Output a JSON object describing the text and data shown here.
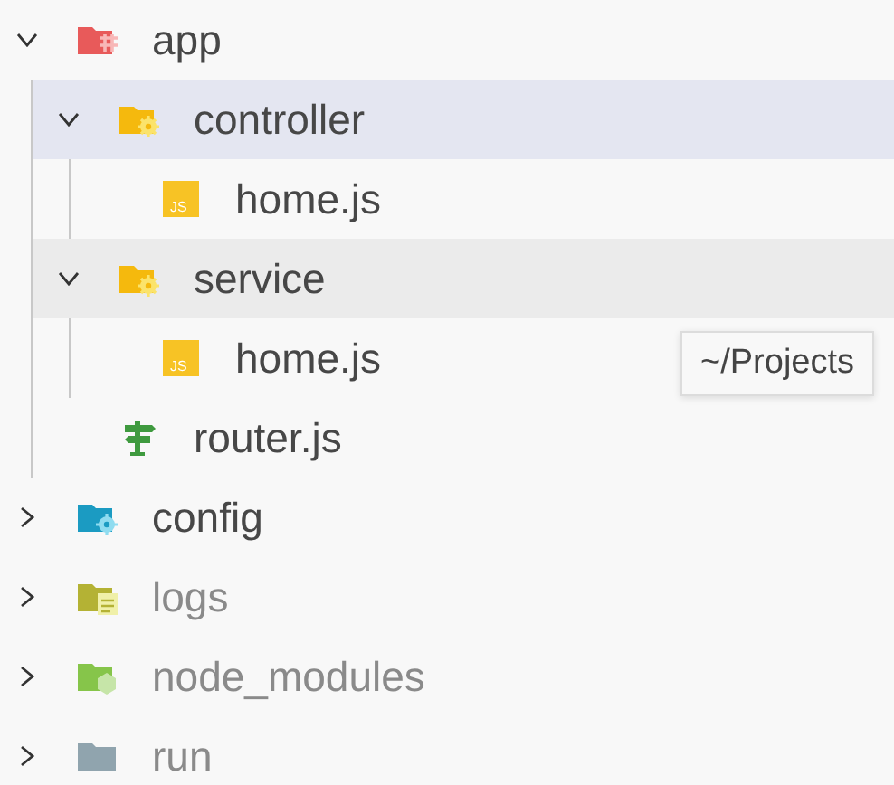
{
  "tree": [
    {
      "name": "app",
      "kind": "folder-app",
      "expanded": true,
      "selected": false,
      "hovered": false,
      "dimmed": false,
      "children": [
        {
          "name": "controller",
          "kind": "folder-gear",
          "expanded": true,
          "selected": true,
          "hovered": false,
          "dimmed": false,
          "children": [
            {
              "name": "home.js",
              "kind": "js",
              "icon_text": "JS",
              "selected": false,
              "hovered": false,
              "dimmed": false
            }
          ]
        },
        {
          "name": "service",
          "kind": "folder-gear",
          "expanded": true,
          "selected": false,
          "hovered": true,
          "dimmed": false,
          "children": [
            {
              "name": "home.js",
              "kind": "js",
              "icon_text": "JS",
              "selected": false,
              "hovered": false,
              "dimmed": false
            }
          ]
        },
        {
          "name": "router.js",
          "kind": "signpost",
          "selected": false,
          "hovered": false,
          "dimmed": false
        }
      ]
    },
    {
      "name": "config",
      "kind": "folder-config",
      "expanded": false,
      "selected": false,
      "hovered": false,
      "dimmed": false
    },
    {
      "name": "logs",
      "kind": "folder-logs",
      "expanded": false,
      "selected": false,
      "hovered": false,
      "dimmed": true
    },
    {
      "name": "node_modules",
      "kind": "folder-node",
      "expanded": false,
      "selected": false,
      "hovered": false,
      "dimmed": true
    },
    {
      "name": "run",
      "kind": "folder",
      "expanded": false,
      "selected": false,
      "hovered": false,
      "dimmed": true
    }
  ],
  "tooltip": {
    "text": "~/Projects"
  }
}
